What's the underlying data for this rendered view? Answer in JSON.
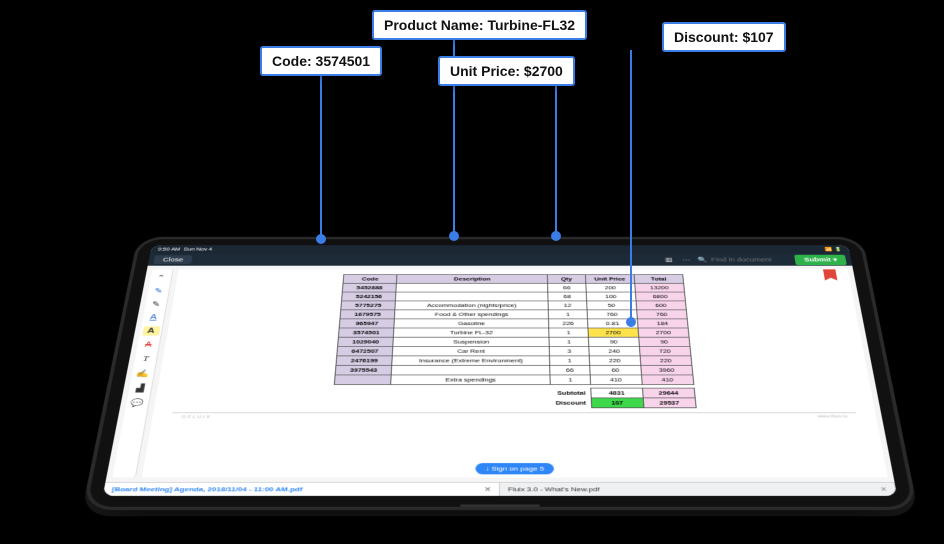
{
  "callouts": {
    "code": "Code: 3574501",
    "product": "Product Name: Turbine-FL32",
    "unit_price": "Unit Price: $2700",
    "discount": "Discount: $107"
  },
  "statusbar": {
    "time": "9:50 AM",
    "date": "Sun Nov 4"
  },
  "toolbar": {
    "close": "Close",
    "search_placeholder": "Find in document",
    "submit": "Submit ▾"
  },
  "table": {
    "headers": {
      "code": "Code",
      "desc": "Description",
      "qty": "Qty",
      "up": "Unit Price",
      "tot": "Total"
    },
    "rows": [
      {
        "code": "5452888",
        "desc": "",
        "qty": "66",
        "up": "200",
        "tot": "13200"
      },
      {
        "code": "5242156",
        "desc": "",
        "qty": "68",
        "up": "100",
        "tot": "6800"
      },
      {
        "code": "5775275",
        "desc": "Accommodation (nights/price)",
        "qty": "12",
        "up": "50",
        "tot": "600"
      },
      {
        "code": "1679575",
        "desc": "Food & Other spendings",
        "qty": "1",
        "up": "760",
        "tot": "760"
      },
      {
        "code": "965947",
        "desc": "Gasoline",
        "qty": "226",
        "up": "0.81",
        "tot": "184"
      },
      {
        "code": "3574501",
        "desc": "Turbine FL-32",
        "qty": "1",
        "up": "2700",
        "tot": "2700",
        "hl_up": true
      },
      {
        "code": "1029040",
        "desc": "Suspension",
        "qty": "1",
        "up": "90",
        "tot": "90"
      },
      {
        "code": "6472507",
        "desc": "Car Rent",
        "qty": "3",
        "up": "240",
        "tot": "720"
      },
      {
        "code": "2476199",
        "desc": "Insurance (Extreme Environment)",
        "qty": "1",
        "up": "220",
        "tot": "220"
      },
      {
        "code": "3975543",
        "desc": "",
        "qty": "66",
        "up": "60",
        "tot": "3960"
      },
      {
        "code": "",
        "desc": "Extra spendings",
        "qty": "1",
        "up": "410",
        "tot": "410"
      }
    ],
    "subtotal_label": "Subtotal",
    "subtotal_val": "4831",
    "subtotal_tot": "29644",
    "discount_label": "Discount",
    "discount_val": "107",
    "discount_tot": "29537"
  },
  "footer": {
    "left": "⊙ F L U I X",
    "right": "www.fluix.io"
  },
  "sign_pill": "↓  Sign on page 5",
  "tabs": {
    "t1": "[Board Meeting] Agenda, 2018/11/04 - 11:00 AM.pdf",
    "t2": "Fluix 3.0 - What's New.pdf"
  }
}
